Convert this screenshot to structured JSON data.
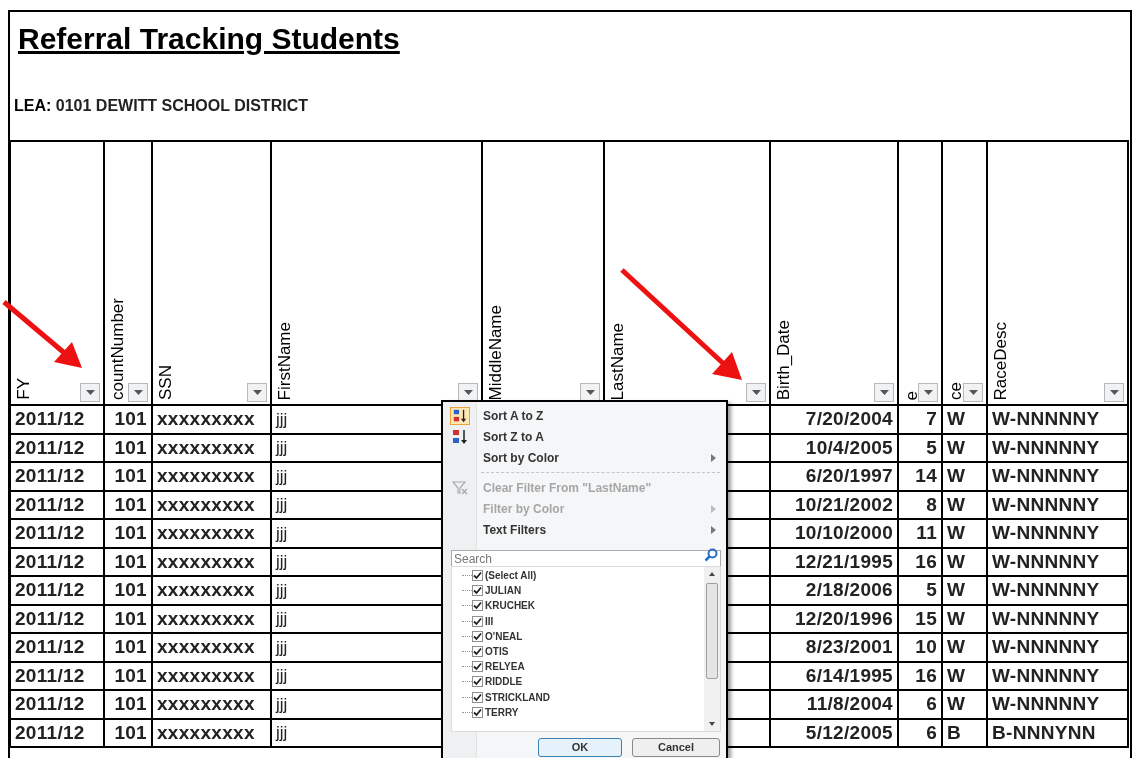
{
  "title": "Referral Tracking Students",
  "lea": {
    "label": "LEA:",
    "value": "0101 DEWITT SCHOOL DISTRICT"
  },
  "table": {
    "columns": [
      {
        "label": "FY"
      },
      {
        "label": "countNumber"
      },
      {
        "label": "SSN"
      },
      {
        "label": "FirstName"
      },
      {
        "label": "MiddleName"
      },
      {
        "label": "LastName"
      },
      {
        "label": "Birth_Date"
      },
      {
        "label": "e"
      },
      {
        "label": "ce"
      },
      {
        "label": "RaceDesc"
      }
    ],
    "rows": [
      {
        "cells": [
          "2011/12",
          "101",
          "xxxxxxxxx",
          "jjj",
          "7/20/2004",
          "7",
          "W",
          "W-NNNNNY"
        ]
      },
      {
        "cells": [
          "2011/12",
          "101",
          "xxxxxxxxx",
          "jjj",
          "10/4/2005",
          "5",
          "W",
          "W-NNNNNY"
        ]
      },
      {
        "cells": [
          "2011/12",
          "101",
          "xxxxxxxxx",
          "jjj",
          "6/20/1997",
          "14",
          "W",
          "W-NNNNNY"
        ]
      },
      {
        "cells": [
          "2011/12",
          "101",
          "xxxxxxxxx",
          "jjj",
          "10/21/2002",
          "8",
          "W",
          "W-NNNNNY"
        ]
      },
      {
        "cells": [
          "2011/12",
          "101",
          "xxxxxxxxx",
          "jjj",
          "10/10/2000",
          "11",
          "W",
          "W-NNNNNY"
        ]
      },
      {
        "cells": [
          "2011/12",
          "101",
          "xxxxxxxxx",
          "jjj",
          "12/21/1995",
          "16",
          "W",
          "W-NNNNNY"
        ]
      },
      {
        "cells": [
          "2011/12",
          "101",
          "xxxxxxxxx",
          "jjj",
          "2/18/2006",
          "5",
          "W",
          "W-NNNNNY"
        ]
      },
      {
        "cells": [
          "2011/12",
          "101",
          "xxxxxxxxx",
          "jjj",
          "12/20/1996",
          "15",
          "W",
          "W-NNNNNY"
        ]
      },
      {
        "cells": [
          "2011/12",
          "101",
          "xxxxxxxxx",
          "jjj",
          "8/23/2001",
          "10",
          "W",
          "W-NNNNNY"
        ]
      },
      {
        "cells": [
          "2011/12",
          "101",
          "xxxxxxxxx",
          "jjj",
          "6/14/1995",
          "16",
          "W",
          "W-NNNNNY"
        ]
      },
      {
        "cells": [
          "2011/12",
          "101",
          "xxxxxxxxx",
          "jjj",
          "11/8/2004",
          "6",
          "W",
          "W-NNNNNY"
        ]
      },
      {
        "cells": [
          "2011/12",
          "101",
          "xxxxxxxxx",
          "jjj",
          "5/12/2005",
          "6",
          "B",
          "B-NNNYNN"
        ]
      }
    ]
  },
  "filter_menu": {
    "items": [
      {
        "kind": "sort-asc",
        "label": "Sort A to Z",
        "disabled": false,
        "submenu": false
      },
      {
        "kind": "sort-desc",
        "label": "Sort Z to A",
        "disabled": false,
        "submenu": false
      },
      {
        "kind": "plain",
        "label": "Sort by Color",
        "disabled": false,
        "submenu": true
      },
      {
        "kind": "separator"
      },
      {
        "kind": "clear-filter",
        "label": "Clear Filter From \"LastName\"",
        "disabled": true,
        "submenu": false
      },
      {
        "kind": "plain",
        "label": "Filter by Color",
        "disabled": true,
        "submenu": true
      },
      {
        "kind": "plain",
        "label": "Text Filters",
        "disabled": false,
        "submenu": true
      }
    ],
    "search": {
      "placeholder": "Search"
    },
    "values": [
      {
        "label": "(Select All)",
        "checked": true
      },
      {
        "label": "JULIAN",
        "checked": true
      },
      {
        "label": "KRUCHEK",
        "checked": true
      },
      {
        "label": "III",
        "checked": true
      },
      {
        "label": "O'NEAL",
        "checked": true
      },
      {
        "label": "OTIS",
        "checked": true
      },
      {
        "label": "RELYEA",
        "checked": true
      },
      {
        "label": "RIDDLE",
        "checked": true
      },
      {
        "label": "STRICKLAND",
        "checked": true
      },
      {
        "label": "TERRY",
        "checked": true
      }
    ],
    "buttons": [
      "OK",
      "Cancel"
    ]
  }
}
